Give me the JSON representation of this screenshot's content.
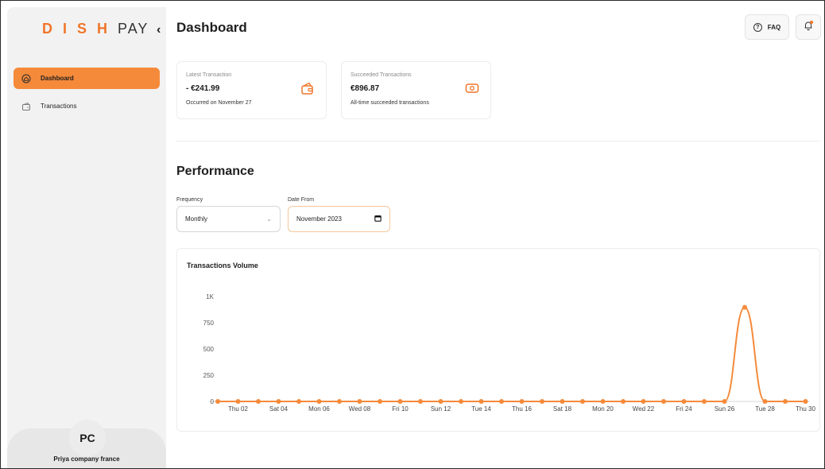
{
  "brand": {
    "logo_bold": "D I S H",
    "logo_light": "PAY",
    "accent": "#f0752a"
  },
  "sidebar": {
    "collapse_icon": "chevron-left-icon",
    "items": [
      {
        "label": "Dashboard",
        "icon": "home-icon",
        "active": true
      },
      {
        "label": "Transactions",
        "icon": "wallet-icon",
        "active": false
      }
    ],
    "user": {
      "initials": "PC",
      "company": "Priya company france"
    }
  },
  "header": {
    "title": "Dashboard",
    "faq_label": "FAQ",
    "faq_icon": "question-icon",
    "bell_icon": "bell-icon"
  },
  "cards": [
    {
      "label": "Latest Transaction",
      "value": "- €241.99",
      "sub": "Occurred on November 27",
      "icon": "wallet-icon"
    },
    {
      "label": "Succeeded Transactions",
      "value": "€896.87",
      "sub": "All-time succeeded transactions",
      "icon": "cash-icon"
    }
  ],
  "performance": {
    "title": "Performance",
    "frequency_label": "Frequency",
    "frequency_value": "Monthly",
    "date_label": "Date From",
    "date_value": "November 2023"
  },
  "chart_data": {
    "type": "line",
    "title": "Transactions Volume",
    "xlabel": "",
    "ylabel": "",
    "ylim": [
      0,
      1000
    ],
    "y_ticks": [
      "0",
      "250",
      "500",
      "750",
      "1K"
    ],
    "x_tick_labels": [
      "Thu 02",
      "Sat 04",
      "Mon 06",
      "Wed 08",
      "Fri 10",
      "Sun 12",
      "Tue 14",
      "Thu 16",
      "Sat 18",
      "Mon 20",
      "Wed 22",
      "Fri 24",
      "Sun 26",
      "Tue 28",
      "Thu 30"
    ],
    "x": [
      1,
      2,
      3,
      4,
      5,
      6,
      7,
      8,
      9,
      10,
      11,
      12,
      13,
      14,
      15,
      16,
      17,
      18,
      19,
      20,
      21,
      22,
      23,
      24,
      25,
      26,
      27,
      28,
      29,
      30
    ],
    "values": [
      0,
      0,
      0,
      0,
      0,
      0,
      0,
      0,
      0,
      0,
      0,
      0,
      0,
      0,
      0,
      0,
      0,
      0,
      0,
      0,
      0,
      0,
      0,
      0,
      0,
      0,
      897,
      0,
      0,
      0
    ],
    "color": "#f58a3b",
    "grid": false
  }
}
